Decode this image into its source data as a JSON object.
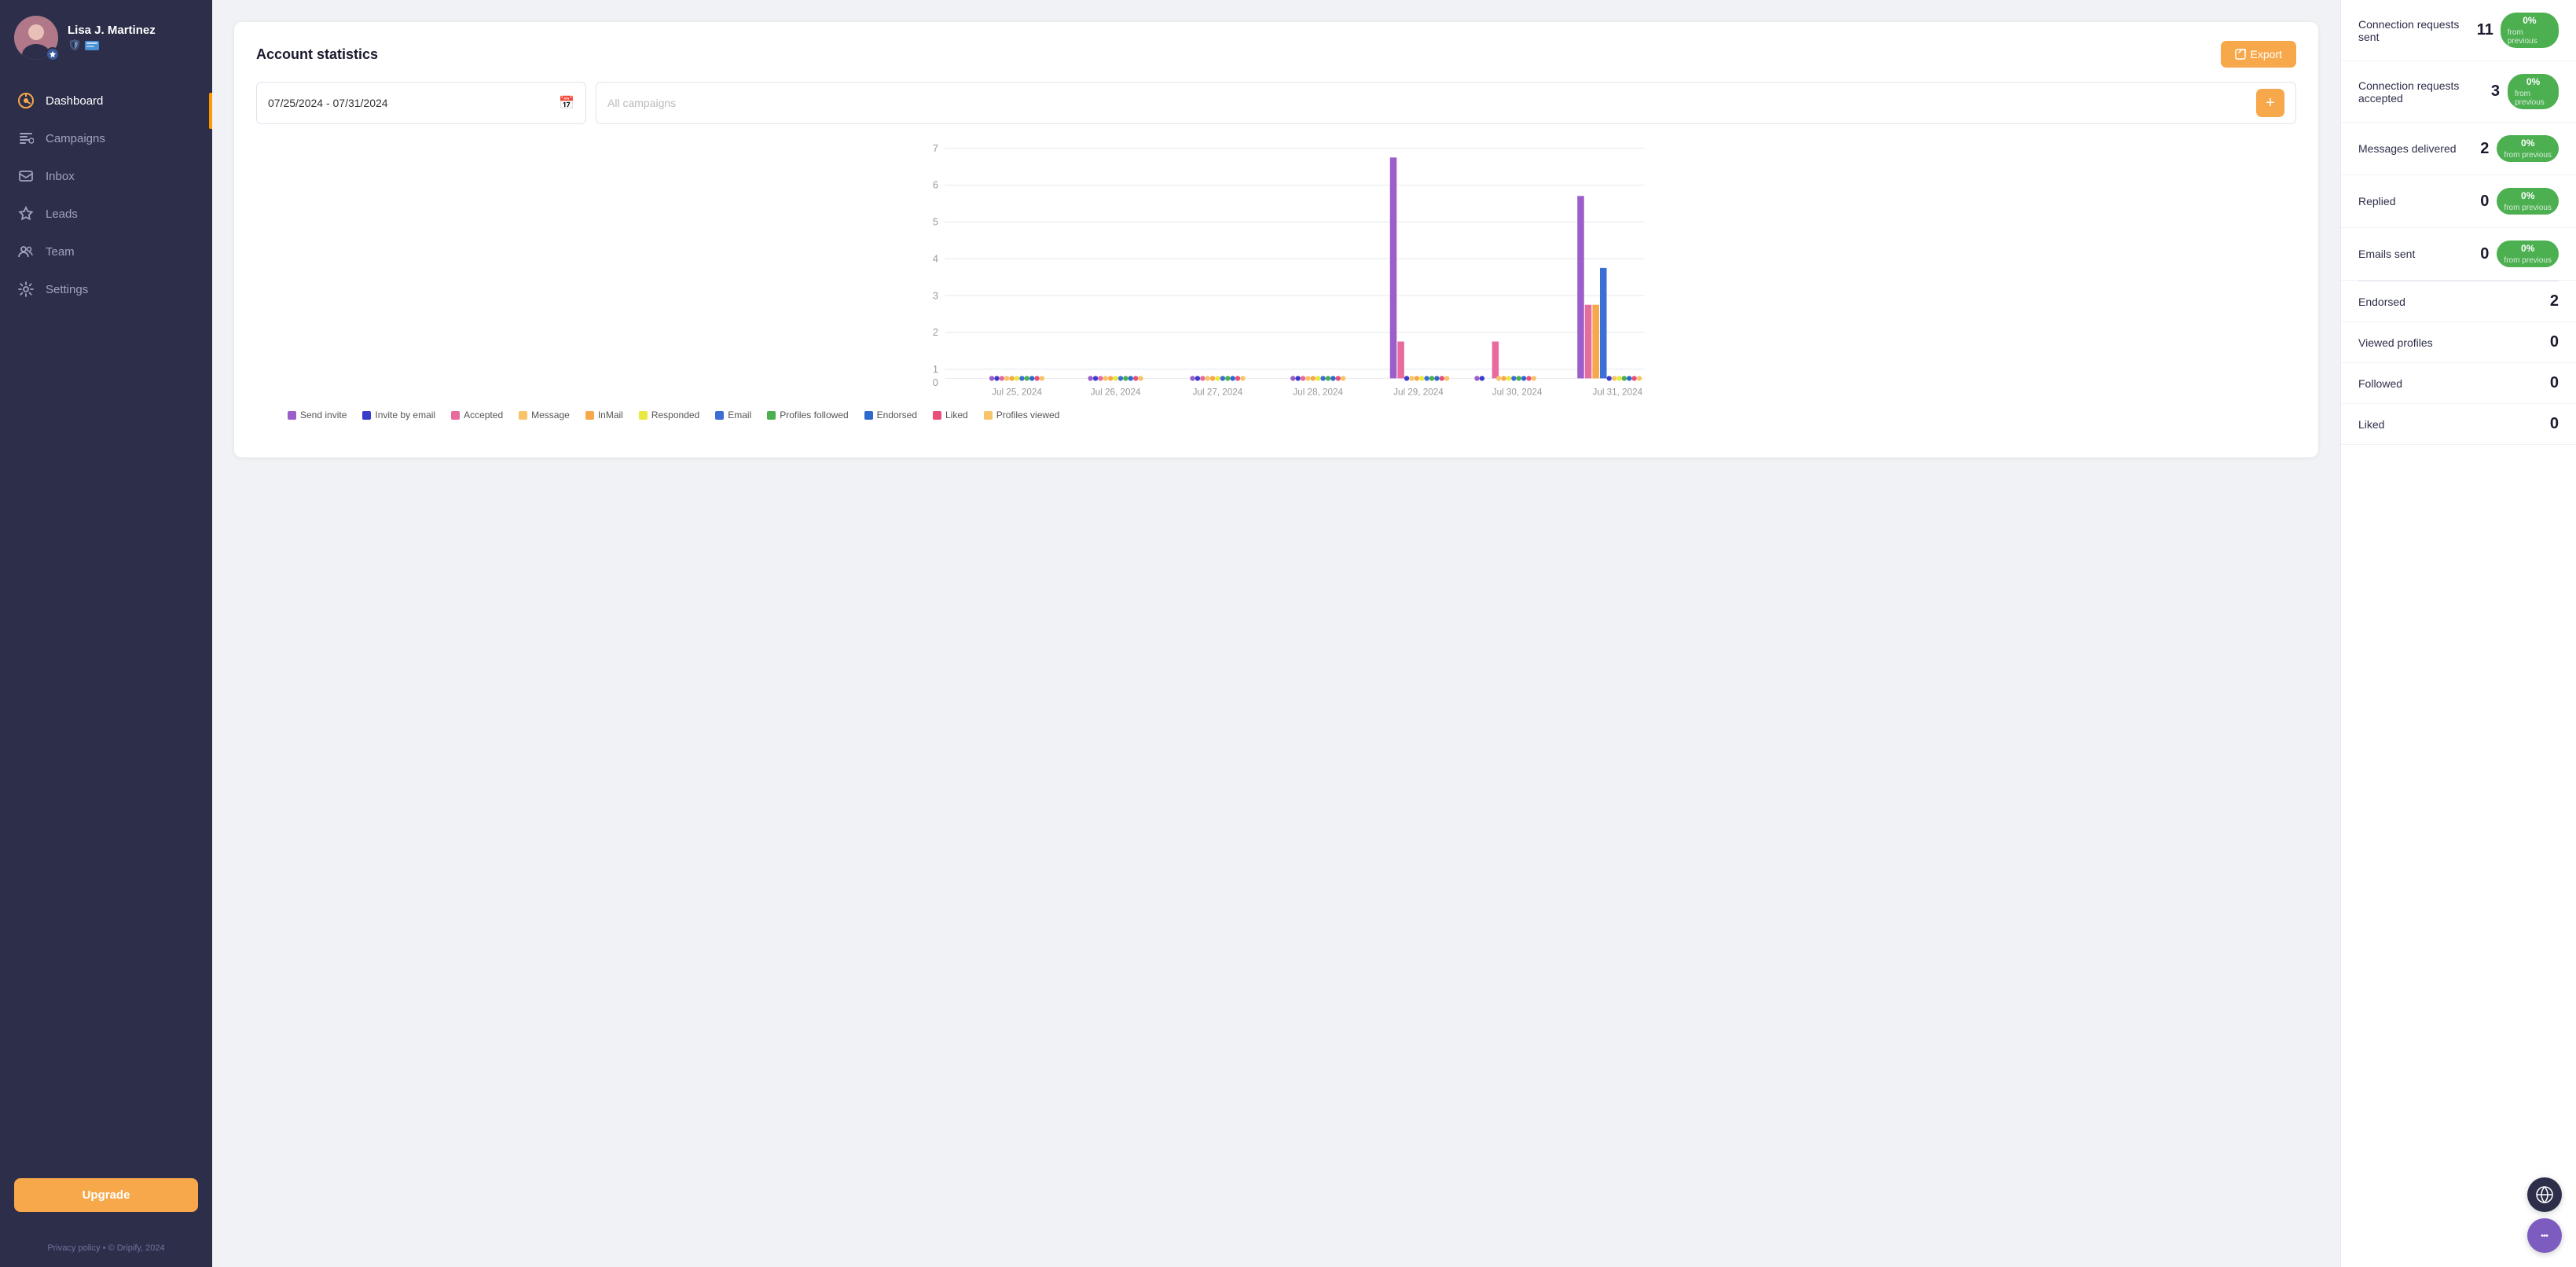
{
  "sidebar": {
    "profile": {
      "name": "Lisa J. Martinez",
      "avatar_alt": "Profile picture"
    },
    "nav_items": [
      {
        "id": "dashboard",
        "label": "Dashboard",
        "icon": "⏱",
        "active": true
      },
      {
        "id": "campaigns",
        "label": "Campaigns",
        "icon": "🏷",
        "active": false
      },
      {
        "id": "inbox",
        "label": "Inbox",
        "icon": "💬",
        "active": false
      },
      {
        "id": "leads",
        "label": "Leads",
        "icon": "⭐",
        "active": false
      },
      {
        "id": "team",
        "label": "Team",
        "icon": "👥",
        "active": false
      },
      {
        "id": "settings",
        "label": "Settings",
        "icon": "⚙",
        "active": false
      }
    ],
    "upgrade_label": "Upgrade",
    "footer_text": "Privacy policy  •  © Dripify, 2024"
  },
  "main": {
    "page_title": "Account statistics",
    "export_label": "Export",
    "date_range": "07/25/2024  -  07/31/2024",
    "campaigns_placeholder": "All campaigns",
    "chart": {
      "y_labels": [
        "0",
        "1",
        "2",
        "3",
        "4",
        "5",
        "6",
        "7"
      ],
      "x_labels": [
        "Jul 25, 2024",
        "Jul 26, 2024",
        "Jul 27, 2024",
        "Jul 28, 2024",
        "Jul 29, 2024",
        "Jul 30, 2024",
        "Jul 31, 2024"
      ],
      "legend": [
        {
          "label": "Send invite",
          "color": "#9c5ec9"
        },
        {
          "label": "Invite by email",
          "color": "#3b3bcc"
        },
        {
          "label": "Accepted",
          "color": "#e86b9e"
        },
        {
          "label": "Message",
          "color": "#f7c46a"
        },
        {
          "label": "InMail",
          "color": "#f7a84a"
        },
        {
          "label": "Responded",
          "color": "#e8e840"
        },
        {
          "label": "Email",
          "color": "#3b6fd4"
        },
        {
          "label": "Profiles followed",
          "color": "#4caf50"
        },
        {
          "label": "Endorsed",
          "color": "#2d6acc"
        },
        {
          "label": "Liked",
          "color": "#e8507a"
        },
        {
          "label": "Profiles viewed",
          "color": "#f7c46a"
        }
      ]
    }
  },
  "right_panel": {
    "stats_with_badge": [
      {
        "label": "Connection requests sent",
        "value": "11",
        "badge_pct": "0%",
        "badge_prev": "from previous"
      },
      {
        "label": "Connection requests accepted",
        "value": "3",
        "badge_pct": "0%",
        "badge_prev": "from previous"
      },
      {
        "label": "Messages delivered",
        "value": "2",
        "badge_pct": "0%",
        "badge_prev": "from previous"
      },
      {
        "label": "Replied",
        "value": "0",
        "badge_pct": "0%",
        "badge_prev": "from previous"
      },
      {
        "label": "Emails sent",
        "value": "0",
        "badge_pct": "0%",
        "badge_prev": "from previous"
      }
    ],
    "stats_simple": [
      {
        "label": "Endorsed",
        "value": "2"
      },
      {
        "label": "Viewed profiles",
        "value": "0"
      },
      {
        "label": "Followed",
        "value": "0"
      },
      {
        "label": "Liked",
        "value": "0"
      }
    ]
  }
}
